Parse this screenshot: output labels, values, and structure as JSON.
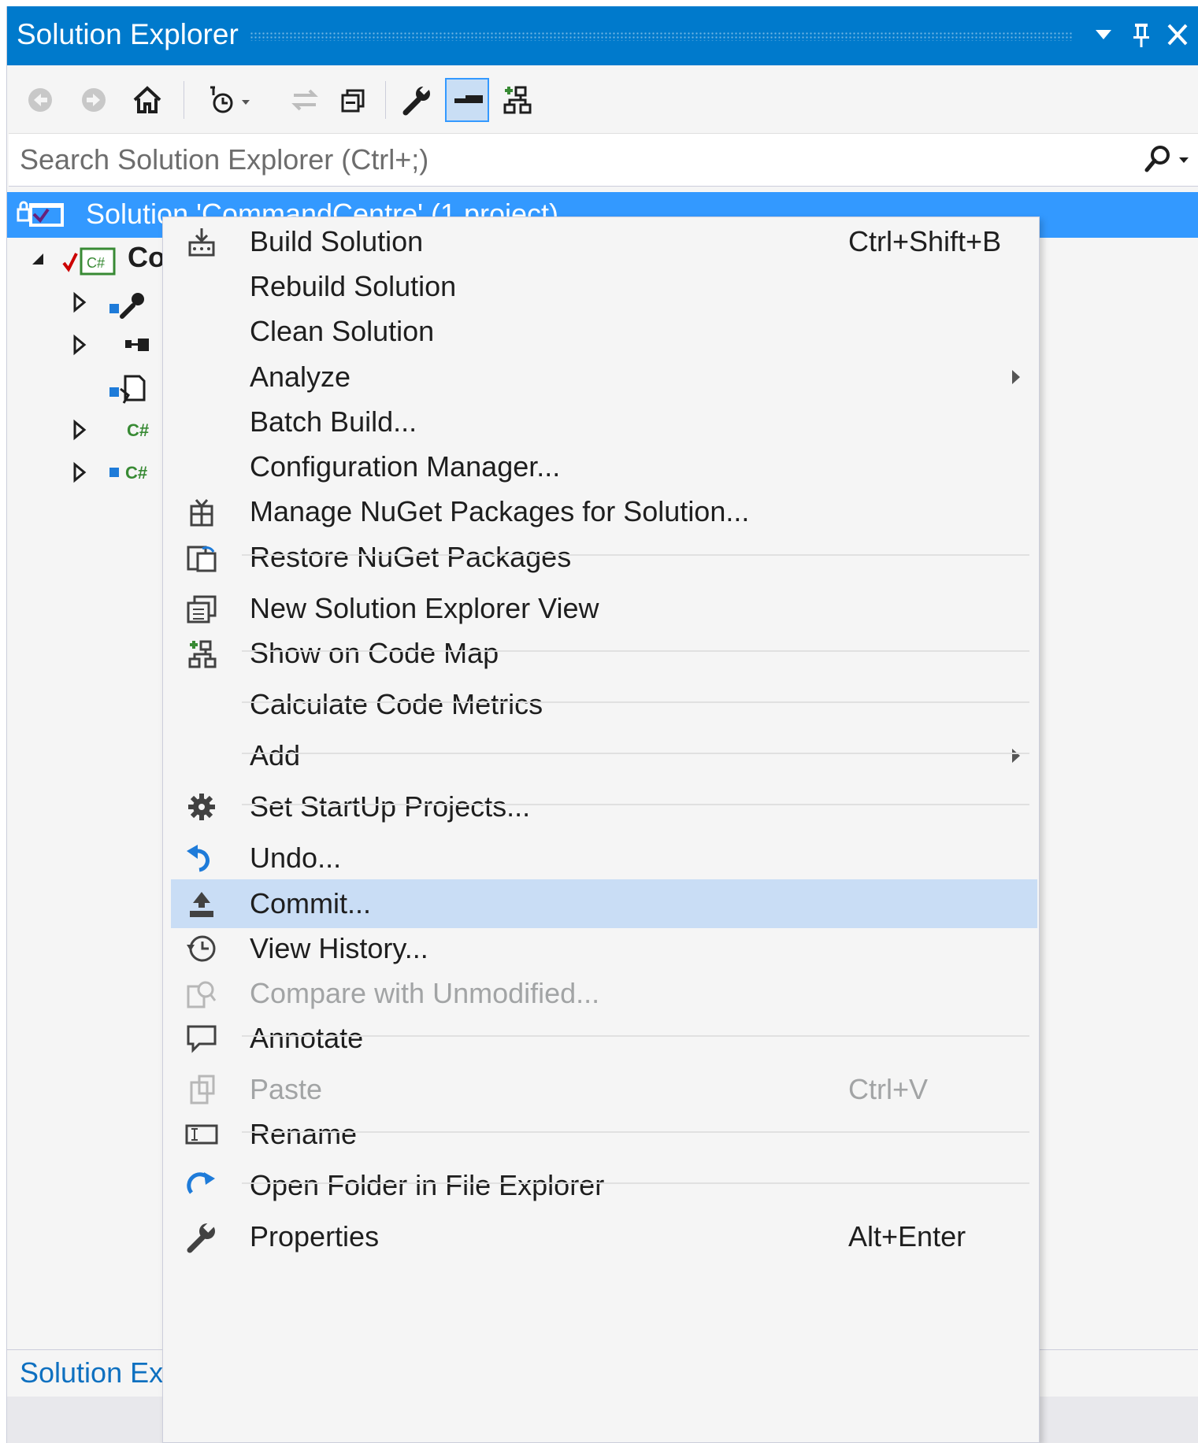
{
  "window": {
    "title": "Solution Explorer"
  },
  "search": {
    "placeholder": "Search Solution Explorer (Ctrl+;)"
  },
  "tree": {
    "solution_label": "Solution 'CommandCentre' (1 project)",
    "project_label": "Co"
  },
  "bottom_tab": {
    "label": "Solution Exp"
  },
  "menu": {
    "items": [
      {
        "label": "Build Solution",
        "shortcut": "Ctrl+Shift+B",
        "icon": "build-icon"
      },
      {
        "label": "Rebuild Solution",
        "shortcut": "",
        "icon": ""
      },
      {
        "label": "Clean Solution",
        "shortcut": "",
        "icon": ""
      },
      {
        "label": "Analyze",
        "shortcut": "",
        "icon": "",
        "submenu": true
      },
      {
        "label": "Batch Build...",
        "shortcut": "",
        "icon": ""
      },
      {
        "label": "Configuration Manager...",
        "shortcut": "",
        "icon": ""
      },
      {
        "label": "Manage NuGet Packages for Solution...",
        "shortcut": "",
        "icon": "nuget-icon"
      },
      {
        "label": "Restore NuGet Packages",
        "shortcut": "",
        "icon": "restore-icon"
      },
      {
        "label": "New Solution Explorer View",
        "shortcut": "",
        "icon": "new-view-icon"
      },
      {
        "label": "Show on Code Map",
        "shortcut": "",
        "icon": "code-map-icon"
      },
      {
        "label": "Calculate Code Metrics",
        "shortcut": "",
        "icon": ""
      },
      {
        "label": "Add",
        "shortcut": "",
        "icon": "",
        "submenu": true
      },
      {
        "label": "Set StartUp Projects...",
        "shortcut": "",
        "icon": "gear-icon"
      },
      {
        "label": "Undo...",
        "shortcut": "",
        "icon": "undo-icon"
      },
      {
        "label": "Commit...",
        "shortcut": "",
        "icon": "commit-icon",
        "highlighted": true
      },
      {
        "label": "View History...",
        "shortcut": "",
        "icon": "history-icon"
      },
      {
        "label": "Compare with Unmodified...",
        "shortcut": "",
        "icon": "compare-icon",
        "disabled": true
      },
      {
        "label": "Annotate",
        "shortcut": "",
        "icon": "annotate-icon"
      },
      {
        "label": "Paste",
        "shortcut": "Ctrl+V",
        "icon": "paste-icon",
        "disabled": true
      },
      {
        "label": "Rename",
        "shortcut": "",
        "icon": "rename-icon"
      },
      {
        "label": "Open Folder in File Explorer",
        "shortcut": "",
        "icon": "open-folder-icon"
      },
      {
        "label": "Properties",
        "shortcut": "Alt+Enter",
        "icon": "wrench-icon"
      }
    ]
  },
  "colors": {
    "accent": "#007acc",
    "selection": "#3399ff",
    "menu_hover": "#c9ddf5",
    "menu_bg": "#f5f5f5",
    "disabled_text": "#a2a4a5"
  }
}
